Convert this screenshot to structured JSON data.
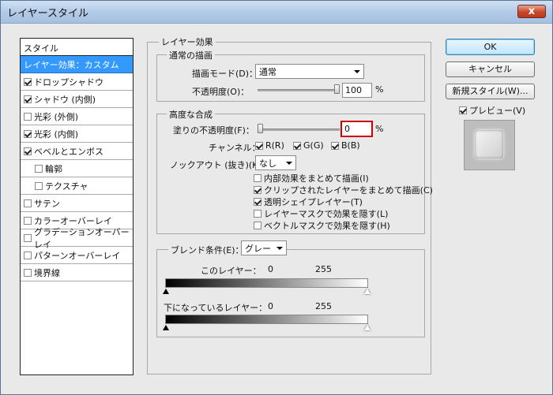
{
  "window": {
    "title": "レイヤースタイル",
    "close_label": "x"
  },
  "left_panel": {
    "header": "スタイル",
    "items": [
      {
        "label": "レイヤー効果：カスタム",
        "checkbox": false,
        "checked": false,
        "selected": true
      },
      {
        "label": "ドロップシャドウ",
        "checkbox": true,
        "checked": true
      },
      {
        "label": "シャドウ (内側)",
        "checkbox": true,
        "checked": true
      },
      {
        "label": "光彩 (外側)",
        "checkbox": true,
        "checked": false
      },
      {
        "label": "光彩 (内側)",
        "checkbox": true,
        "checked": true
      },
      {
        "label": "ベベルとエンボス",
        "checkbox": true,
        "checked": true
      },
      {
        "label": "輪郭",
        "checkbox": true,
        "checked": false,
        "indent": true
      },
      {
        "label": "テクスチャ",
        "checkbox": true,
        "checked": false,
        "indent": true
      },
      {
        "label": "サテン",
        "checkbox": true,
        "checked": false
      },
      {
        "label": "カラーオーバーレイ",
        "checkbox": true,
        "checked": false
      },
      {
        "label": "グラデーションオーバーレイ",
        "checkbox": true,
        "checked": false
      },
      {
        "label": "パターンオーバーレイ",
        "checkbox": true,
        "checked": false
      },
      {
        "label": "境界線",
        "checkbox": true,
        "checked": false
      }
    ]
  },
  "layer_effects": {
    "title": "レイヤー効果",
    "normal_blend": {
      "title": "通常の描画",
      "blend_mode_label": "描画モード(D)：",
      "blend_mode_value": "通常",
      "opacity_label": "不透明度(O)：",
      "opacity_value": "100",
      "opacity_unit": "%",
      "opacity_level": 1.0
    },
    "advanced_blend": {
      "title": "高度な合成",
      "fill_opacity_label": "塗りの不透明度(F)：",
      "fill_opacity_value": "0",
      "fill_opacity_unit": "%",
      "fill_opacity_level": 0.0,
      "channels_label": "チャンネル：",
      "channels": [
        {
          "label": "R(R)",
          "checked": true
        },
        {
          "label": "G(G)",
          "checked": true
        },
        {
          "label": "B(B)",
          "checked": true
        }
      ],
      "knockout_label": "ノックアウト (抜き)(K)：",
      "knockout_value": "なし",
      "options": [
        {
          "label": "内部効果をまとめて描画(I)",
          "checked": false
        },
        {
          "label": "クリップされたレイヤーをまとめて描画(C)",
          "checked": true
        },
        {
          "label": "透明シェイプレイヤー(T)",
          "checked": true
        },
        {
          "label": "レイヤーマスクで効果を隠す(L)",
          "checked": false
        },
        {
          "label": "ベクトルマスクで効果を隠す(H)",
          "checked": false
        }
      ]
    },
    "blend_if": {
      "label": "ブレンド条件(E)：",
      "value": "グレー",
      "this_layer_label": "このレイヤー：",
      "this_layer_min": "0",
      "this_layer_max": "255",
      "underlying_label": "下になっているレイヤー：",
      "underlying_min": "0",
      "underlying_max": "255"
    }
  },
  "buttons": {
    "ok": "OK",
    "cancel": "キャンセル",
    "new_style": "新規スタイル(W)...",
    "preview_label": "プレビュー(V)",
    "preview_checked": true
  },
  "colors": {
    "selection": "#3399ff",
    "highlight_box": "#cc0000"
  }
}
